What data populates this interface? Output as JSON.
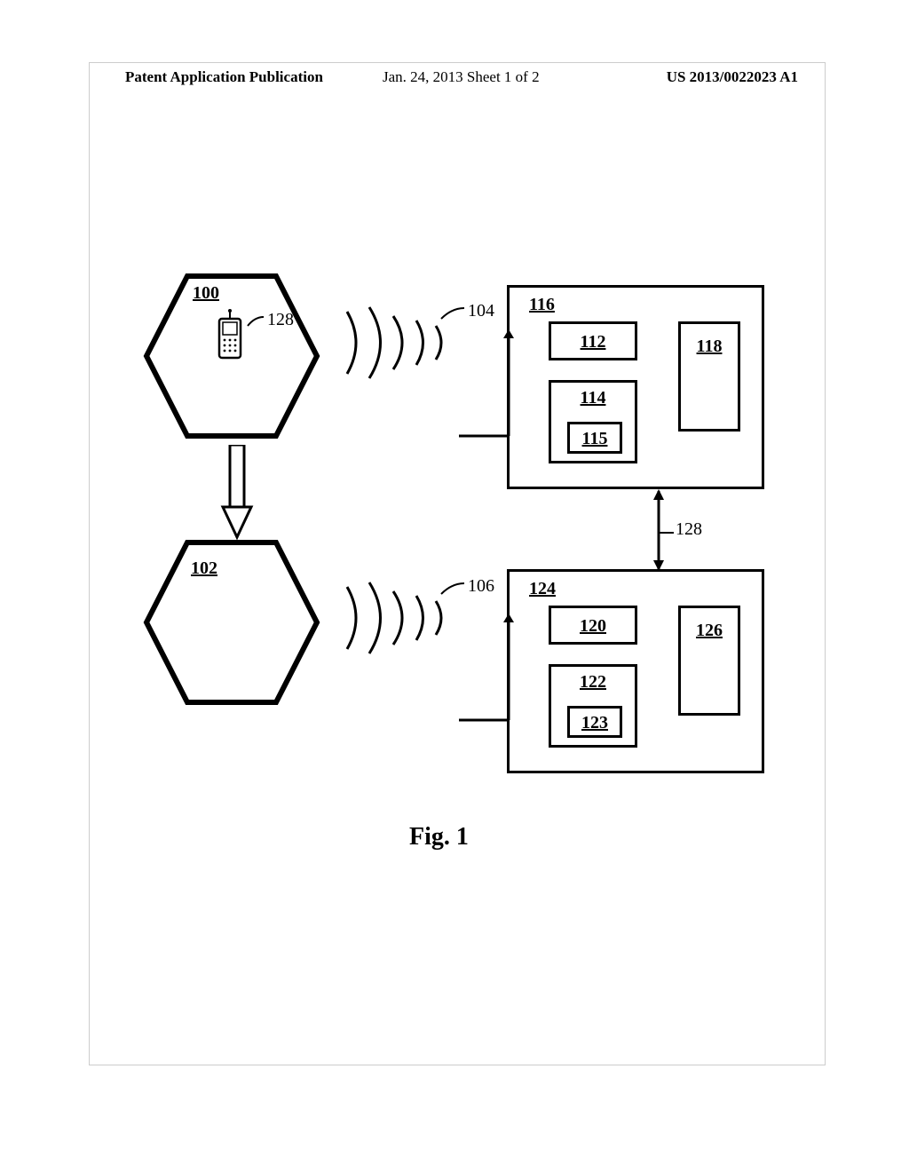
{
  "header": {
    "left": "Patent Application Publication",
    "mid": "Jan. 24, 2013  Sheet 1 of 2",
    "right": "US 2013/0022023 A1"
  },
  "hex": {
    "top": "100",
    "bottom": "102"
  },
  "phone_label": "128",
  "waves": {
    "top": "104",
    "bottom": "106"
  },
  "link_label": "128",
  "node_top": {
    "outer": "116",
    "b112": "112",
    "b114": "114",
    "b115": "115",
    "b118": "118"
  },
  "node_bottom": {
    "outer": "124",
    "b120": "120",
    "b122": "122",
    "b123": "123",
    "b126": "126"
  },
  "figure_caption": "Fig. 1"
}
